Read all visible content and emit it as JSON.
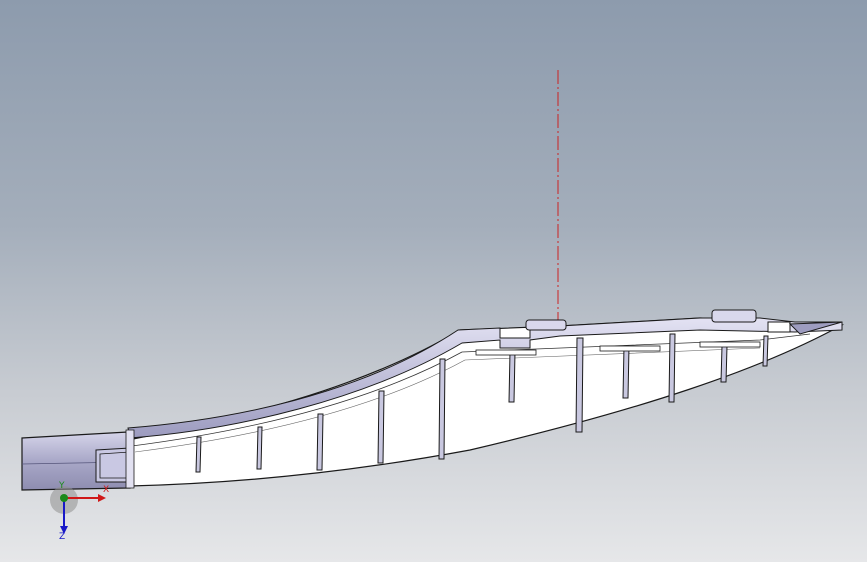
{
  "viewport": {
    "background_top": "#8d9bad",
    "background_bottom": "#e6e7e9"
  },
  "model": {
    "part_color": "#ffffff",
    "edge_color": "#1a1a1a",
    "shade_color": "#b9b8d6",
    "centerline_color": "#cc2222"
  },
  "triad": {
    "x_label": "X",
    "y_label": "Y",
    "z_label": "Z",
    "x_color": "#d01818",
    "y_color": "#1a8a1a",
    "z_color": "#1818c8"
  }
}
